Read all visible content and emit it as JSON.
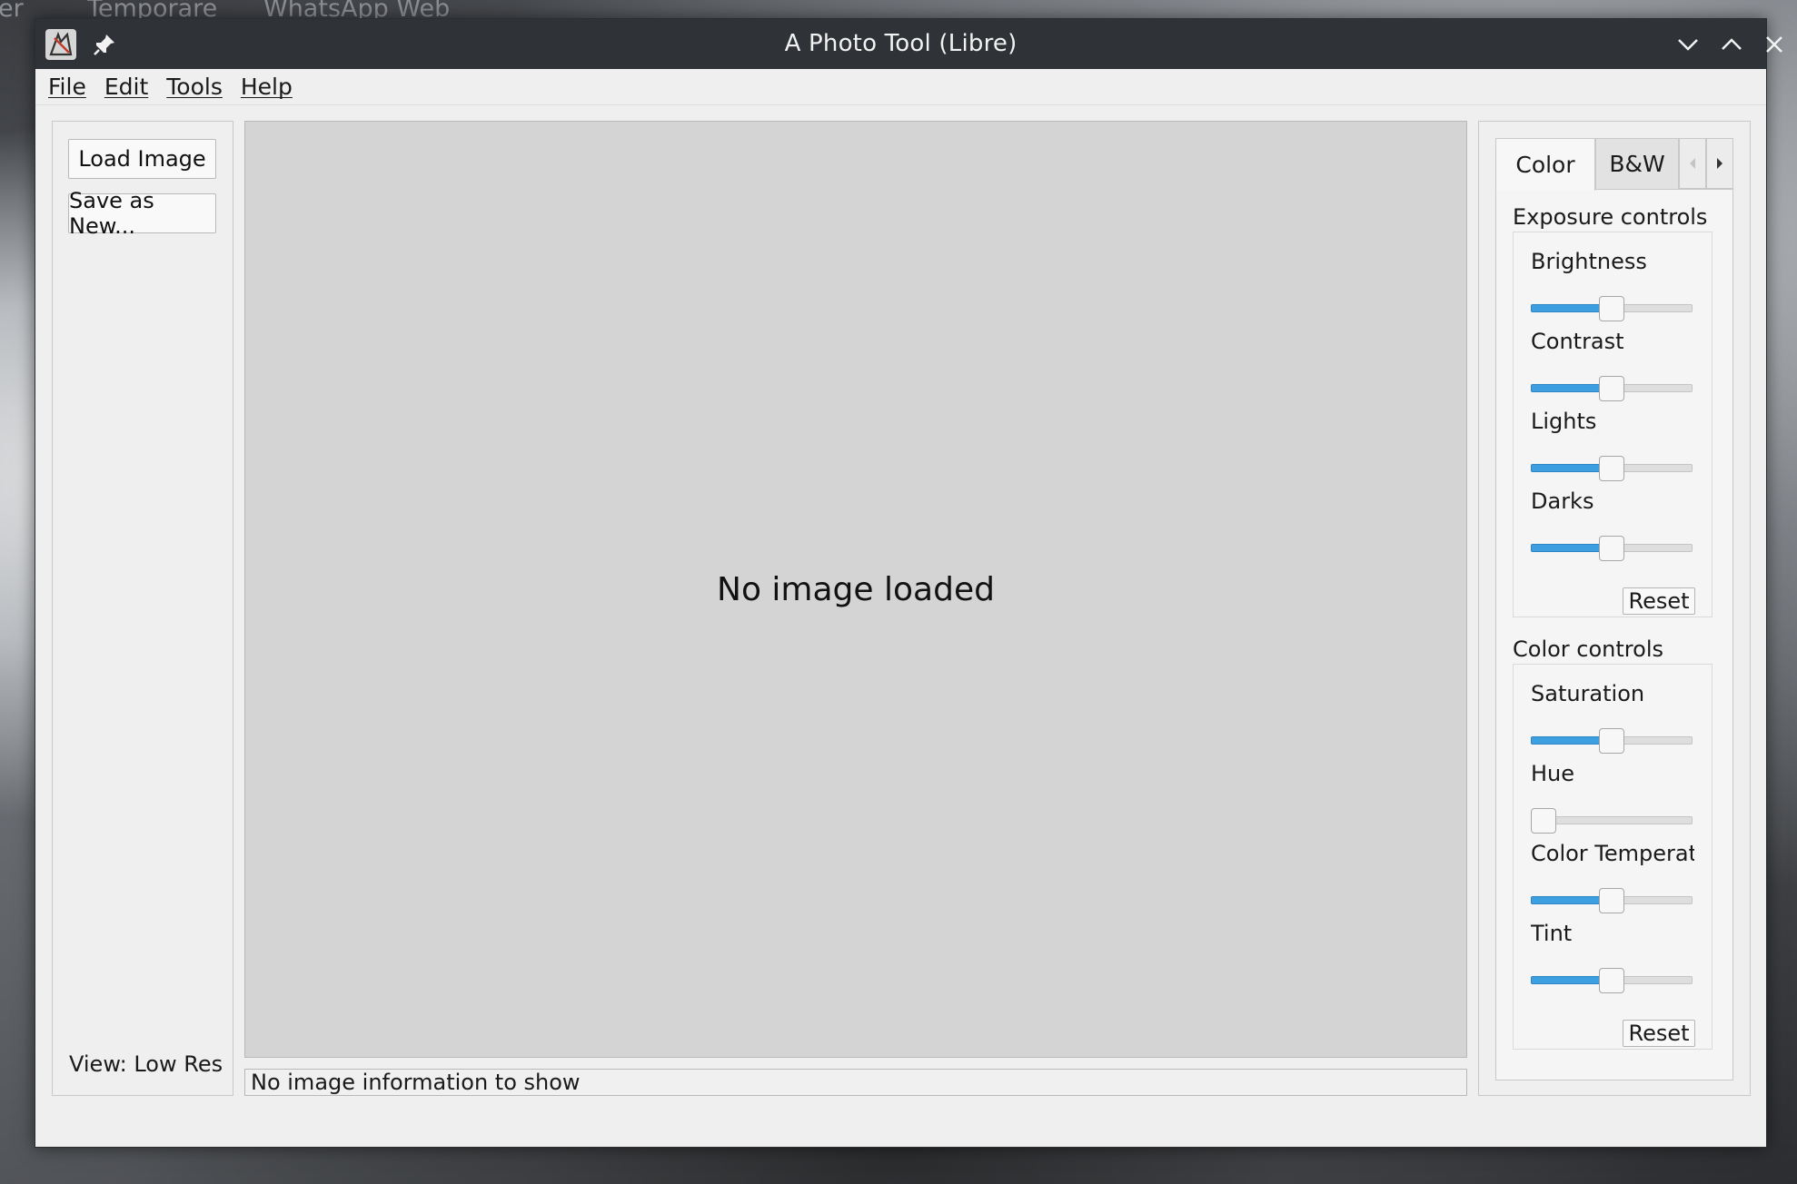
{
  "desktop": {
    "taskbar_left": "er",
    "taskbar_items": [
      "Temporäre",
      "WhatsApp Web"
    ]
  },
  "window": {
    "title": "A Photo Tool (Libre)",
    "icons": {
      "app": "photo-tool-app-icon",
      "pin": "pin-icon",
      "minimize": "chevron-down-icon",
      "maximize": "chevron-up-icon",
      "close": "close-icon"
    }
  },
  "menu": [
    "File",
    "Edit",
    "Tools",
    "Help"
  ],
  "left_panel": {
    "load_button": "Load Image",
    "save_button": "Save as New...",
    "view_label": "View: Low Res"
  },
  "canvas": {
    "message": "No image loaded",
    "info": "No image information to show"
  },
  "right_panel": {
    "tabs": [
      "Color",
      "B&W"
    ],
    "active_tab": "Color",
    "exposure": {
      "title": "Exposure controls",
      "sliders": [
        {
          "label": "Brightness",
          "value": 0.5
        },
        {
          "label": "Contrast",
          "value": 0.5
        },
        {
          "label": "Lights",
          "value": 0.5
        },
        {
          "label": "Darks",
          "value": 0.5
        }
      ],
      "reset": "Reset"
    },
    "color": {
      "title": "Color controls",
      "sliders": [
        {
          "label": "Saturation",
          "value": 0.5
        },
        {
          "label": "Hue",
          "value": 0.0
        },
        {
          "label": "Color Temperatu",
          "value": 0.5
        },
        {
          "label": "Tint",
          "value": 0.5
        }
      ],
      "reset": "Reset"
    }
  },
  "colors": {
    "accent": "#3d9ee0",
    "titlebar": "#2f3337",
    "canvas": "#d4d4d4",
    "window_bg": "#efefef"
  }
}
